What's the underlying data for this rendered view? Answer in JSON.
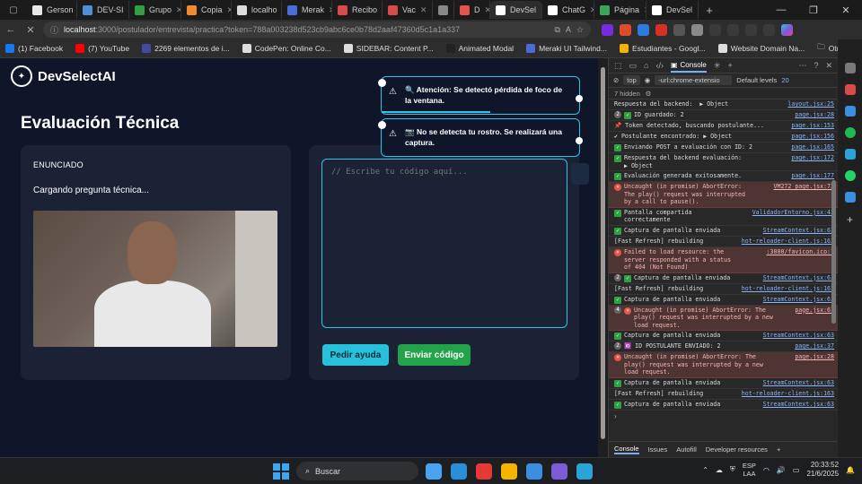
{
  "browser": {
    "tabs": [
      {
        "label": "Gerson",
        "color": "#e8e8e8"
      },
      {
        "label": "DEV-SI",
        "color": "#4f8fd6"
      },
      {
        "label": "Grupo",
        "color": "#2ea043"
      },
      {
        "label": "Copia",
        "color": "#f28b30"
      },
      {
        "label": "localho",
        "color": "#dddddd"
      },
      {
        "label": "Merak",
        "color": "#4a6cd8"
      },
      {
        "label": "Recibo",
        "color": "#d94b4b"
      },
      {
        "label": "Vac",
        "color": "#d94b4b"
      },
      {
        "label": "",
        "color": "#888888"
      },
      {
        "label": "D",
        "color": "#e5534b"
      },
      {
        "label": "DevSel",
        "color": "#ffffff"
      },
      {
        "label": "ChatG",
        "color": "#ffffff"
      },
      {
        "label": "Página",
        "color": "#3ba55d"
      },
      {
        "label": "DevSel",
        "color": "#ffffff"
      }
    ],
    "new_tab": "+",
    "url_host": "localhost",
    "url_path": ":3000/postulador/entrevista/practica?token=788a003238",
    "url_rest": "d523cb9abc6ce0b78d2aaf47360d5c1a1a337",
    "bookmarks": [
      {
        "label": "(1) Facebook",
        "color": "#1877f2"
      },
      {
        "label": "(7) YouTube",
        "color": "#ff0000"
      },
      {
        "label": "2269 elementos de i...",
        "color": "#444aa0"
      },
      {
        "label": "CodePen: Online Co...",
        "color": "#dddddd"
      },
      {
        "label": "SIDEBAR: Content P...",
        "color": "#dddddd"
      },
      {
        "label": "Animated Modal",
        "color": "#222222"
      },
      {
        "label": "Meraki UI Tailwind...",
        "color": "#4a6cd8"
      },
      {
        "label": "Estudiantes - Googl...",
        "color": "#f4b400"
      },
      {
        "label": "Website Domain Na...",
        "color": "#dddddd"
      }
    ],
    "other_bookmarks": "Otros favoritos"
  },
  "app": {
    "brand": "DevSelectAI",
    "title": "Evaluación Técnica",
    "enunciado_label": "ENUNCIADO",
    "loading": "Cargando pregunta técnica...",
    "code_placeholder": "// Escribe tu código aquí...",
    "help_button": "Pedir ayuda",
    "send_button": "Enviar código",
    "toasts": [
      {
        "text": "🔍 Atención: Se detectó pérdida de foco de la ventana.",
        "progress": 0.55
      },
      {
        "text": "📷 No se detecta tu rostro. Se realizará una captura.",
        "progress": 0.0
      }
    ]
  },
  "devtools": {
    "tab_label": "Console",
    "context": "top",
    "filter_value": "-url:chrome-extensio",
    "levels": "Default levels",
    "issues_count": "20",
    "hidden_label": "7 hidden",
    "logs": [
      {
        "type": "info",
        "count": "",
        "msg": "Respuesta del backend:  ▶ Object",
        "src": "layout.jsx:25"
      },
      {
        "type": "ok",
        "count": "2",
        "msg": "ID guardado: 2",
        "src": "page.jsx:28"
      },
      {
        "type": "info",
        "count": "",
        "msg": "📌 Token detectado, buscando postulante...",
        "src": "page.jsx:153"
      },
      {
        "type": "info",
        "count": "",
        "msg": "✔ Postulante encontrado: ▶ Object",
        "src": "page.jsx:156"
      },
      {
        "type": "ok",
        "count": "",
        "msg": "Enviando POST a evaluación con ID: 2",
        "src": "page.jsx:165"
      },
      {
        "type": "ok",
        "count": "",
        "msg": "Respuesta del backend evaluación:\n▶ Object",
        "src": "page.jsx:172"
      },
      {
        "type": "ok",
        "count": "",
        "msg": "Evaluación generada exitosamente.",
        "src": "page.jsx:177"
      },
      {
        "type": "error",
        "count": "",
        "msg": "Uncaught (in promise) AbortError:\nThe play() request was interrupted\nby a call to pause().",
        "src": "VM272 page.jsx:73"
      },
      {
        "type": "ok",
        "count": "",
        "msg": "Pantalla compartida\ncorrectamente",
        "src": "ValidadorEntorno.jsx:43"
      },
      {
        "type": "ok",
        "count": "",
        "msg": "Captura de pantalla enviada",
        "src": "StreamContext.jsx:63"
      },
      {
        "type": "info",
        "count": "",
        "msg": "[Fast Refresh] rebuilding",
        "src": "hot-reloader-client.js:163"
      },
      {
        "type": "error",
        "count": "",
        "msg": "Failed to load resource: the\nserver responded with a status\nof 404 (Not Found)",
        "src": ":3000/favicon.ico:1"
      },
      {
        "type": "ok",
        "count": "2",
        "msg": "Captura de pantalla enviada",
        "src": "StreamContext.jsx:63"
      },
      {
        "type": "info",
        "count": "",
        "msg": "[Fast Refresh] rebuilding",
        "src": "hot-reloader-client.js:163"
      },
      {
        "type": "ok",
        "count": "",
        "msg": "Captura de pantalla enviada",
        "src": "StreamContext.jsx:63"
      },
      {
        "type": "error",
        "count": "4",
        "msg": "Uncaught (in promise) AbortError: The\nplay() request was interrupted by a new\nload request.",
        "src": "page.jsx:61"
      },
      {
        "type": "ok",
        "count": "",
        "msg": "Captura de pantalla enviada",
        "src": "StreamContext.jsx:63"
      },
      {
        "type": "info",
        "count": "2",
        "msg": "🆔 ID POSTULANTE ENVIADO: 2",
        "src": "page.jsx:37"
      },
      {
        "type": "error",
        "count": "",
        "msg": "Uncaught (in promise) AbortError: The\nplay() request was interrupted by a new\nload request.",
        "src": "page.jsx:28"
      },
      {
        "type": "ok",
        "count": "",
        "msg": "Captura de pantalla enviada",
        "src": "StreamContext.jsx:63"
      },
      {
        "type": "info",
        "count": "",
        "msg": "[Fast Refresh] rebuilding",
        "src": "hot-reloader-client.js:163"
      },
      {
        "type": "ok",
        "count": "",
        "msg": "Captura de pantalla enviada",
        "src": "StreamContext.jsx:63"
      }
    ],
    "bottom_tabs": [
      "Console",
      "Issues",
      "Autofill",
      "Developer resources"
    ]
  },
  "taskbar": {
    "search": "Buscar",
    "apps": [
      "#4aa3f0",
      "#2a8fd6",
      "#e53935",
      "#f4b400",
      "#3b8ee0",
      "#7b5cd6",
      "#2aa4d6"
    ],
    "lang_1": "ESP",
    "lang_2": "LAA",
    "time": "20:33:52",
    "date": "21/6/2025"
  },
  "colors": {
    "accent": "#27c1dc",
    "success": "#22a34a",
    "page_bg": "#0f1629",
    "card_bg": "#1b2236"
  }
}
